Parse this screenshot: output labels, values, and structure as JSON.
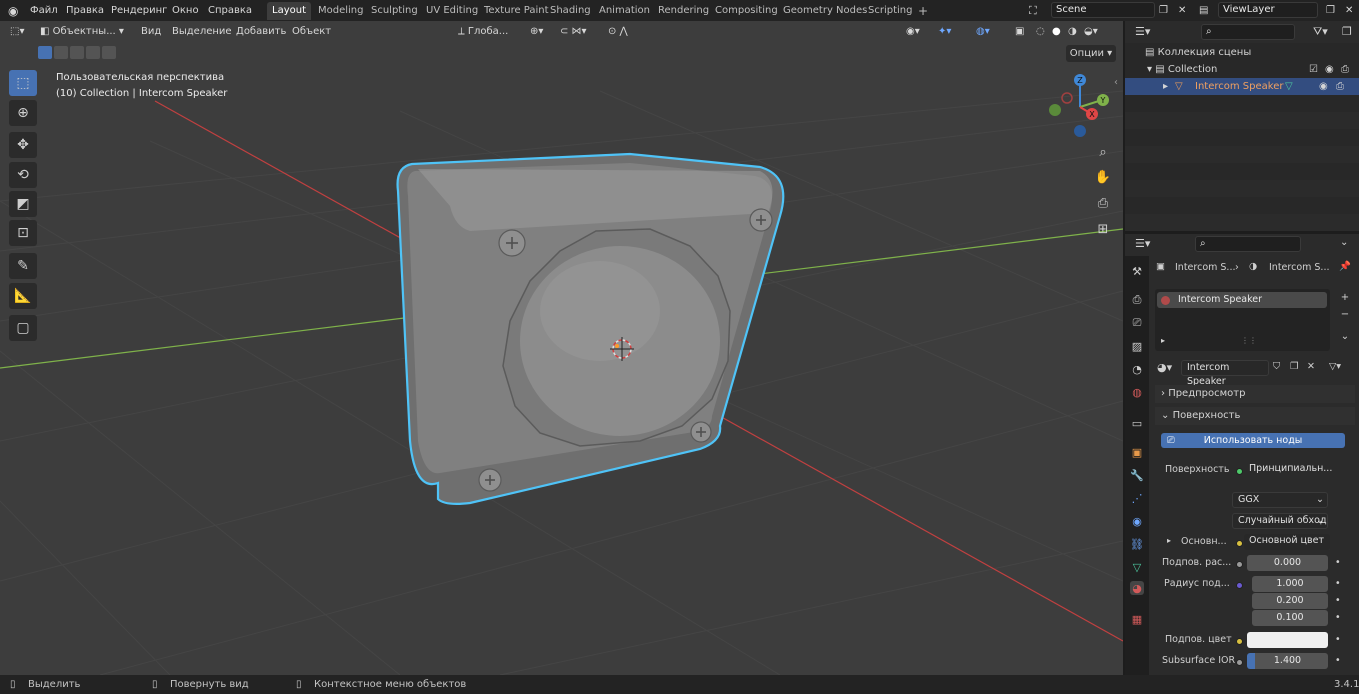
{
  "topbar": {
    "menus": [
      "Файл",
      "Правка",
      "Рендеринг",
      "Окно",
      "Справка"
    ],
    "workspaces": [
      "Layout",
      "Modeling",
      "Sculpting",
      "UV Editing",
      "Texture Paint",
      "Shading",
      "Animation",
      "Rendering",
      "Compositing",
      "Geometry Nodes",
      "Scripting"
    ],
    "active_workspace": "Layout",
    "add_tab": "+",
    "scene": "Scene",
    "view_layer": "ViewLayer"
  },
  "viewport": {
    "mode": "Объектны...",
    "menus": [
      "Вид",
      "Выделение",
      "Добавить",
      "Объект"
    ],
    "orientation": "Глоба...",
    "options": "Опции",
    "overlay_title": "Пользовательская перспектива",
    "overlay_subtitle": "(10) Collection | Intercom Speaker",
    "gizmo": {
      "x": "X",
      "y": "Y",
      "z": "Z"
    }
  },
  "outliner": {
    "root": "Коллекция сцены",
    "collection": "Collection",
    "object": "Intercom Speaker"
  },
  "properties": {
    "breadcrumb_object": "Intercom S...",
    "breadcrumb_material": "Intercom S...",
    "material_slot": "Intercom Speaker",
    "material_name": "Intercom Speaker",
    "panel_preview": "Предпросмотр",
    "panel_surface": "Поверхность",
    "use_nodes": "Использовать ноды",
    "surface_label": "Поверхность",
    "surface_value": "Принципиальн...",
    "distribution": "GGX",
    "subsurface_method": "Случайный обход",
    "base_label": "Основн...",
    "base_value": "Основной цвет",
    "subsurface_label": "Подпов. рас...",
    "subsurface_value": "0.000",
    "radius_label": "Радиус под...",
    "radius_values": [
      "1.000",
      "0.200",
      "0.100"
    ],
    "sub_color_label": "Подпов. цвет",
    "sub_ior_label": "Subsurface IOR",
    "sub_ior_value": "1.400"
  },
  "status": {
    "select": "Выделить",
    "rotate": "Повернуть вид",
    "context": "Контекстное меню объектов",
    "version": "3.4.1"
  },
  "colors": {
    "accent": "#4772b3",
    "selection_outline": "#4fc3f7",
    "x_axis": "#e04646",
    "y_axis": "#7fb24a",
    "z_axis": "#3f88d8"
  }
}
